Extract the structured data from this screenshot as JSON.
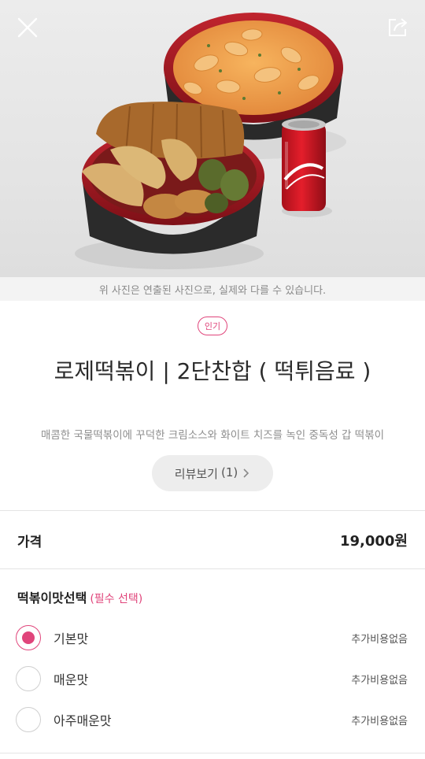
{
  "photo_notice": "위 사진은 연출된 사진으로, 실제와 다를 수 있습니다.",
  "badge": "인기",
  "product": {
    "title": "로제떡볶이 | 2단찬합 ( 떡튀음료 )",
    "description": "매콤한 국물떡볶이에 꾸덕한 크림소스와 화이트 치즈를 녹인 중독성 갑 떡볶이"
  },
  "review_button": {
    "label": "리뷰보기",
    "count": "(1)"
  },
  "price": {
    "label": "가격",
    "value": "19,000원"
  },
  "option_group": {
    "title": "떡볶이맛선택",
    "required_label": "(필수 선택)",
    "options": [
      {
        "name": "기본맛",
        "extra": "추가비용없음",
        "selected": true
      },
      {
        "name": "매운맛",
        "extra": "추가비용없음",
        "selected": false
      },
      {
        "name": "아주매운맛",
        "extra": "추가비용없음",
        "selected": false
      }
    ]
  },
  "icons": {
    "close": "close-icon",
    "share": "share-icon",
    "chevron": "chevron-right-icon"
  },
  "colors": {
    "accent": "#e0457b"
  },
  "photo_image": "food product photo: rosé tteokbokki bowl, fried combo bowl with cutlet, dumplings, sundae and seaweed rolls, and a cola can"
}
